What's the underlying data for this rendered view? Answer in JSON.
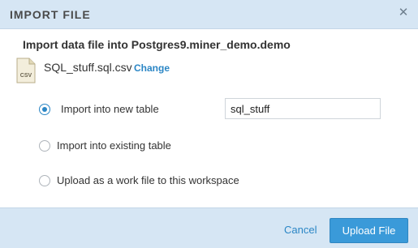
{
  "dialog": {
    "title": "IMPORT FILE",
    "subtitle": "Import data file into Postgres9.miner_demo.demo"
  },
  "file": {
    "icon_label": "CSV",
    "name": "SQL_stuff.sql.csv",
    "change_label": "Change"
  },
  "options": [
    {
      "label": "Import into new table",
      "checked": true
    },
    {
      "label": "Import into existing table",
      "checked": false
    },
    {
      "label": "Upload as a work file to this workspace",
      "checked": false
    }
  ],
  "table_name_input": {
    "value": "sql_stuff"
  },
  "footer": {
    "cancel_label": "Cancel",
    "upload_label": "Upload File"
  },
  "colors": {
    "accent": "#2b86c5",
    "header_bg": "#d6e6f4",
    "button_bg": "#3a9ad9"
  },
  "icons": [
    "close-icon",
    "csv-file-icon",
    "radio-button-icon"
  ]
}
